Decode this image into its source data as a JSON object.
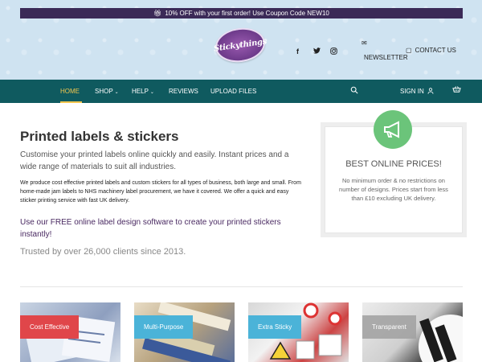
{
  "promo": {
    "icon": "gift-icon",
    "text": "10% OFF with your first order! Use Coupon Code NEW10"
  },
  "logo": {
    "text": "Stickythings",
    "color": "#6d3a8a"
  },
  "social": {
    "facebook": "f",
    "twitter": "t",
    "instagram": "ig"
  },
  "header_links": {
    "newsletter": "NEWSLETTER",
    "contact": "CONTACT US"
  },
  "nav": {
    "items": [
      {
        "label": "HOME",
        "active": true
      },
      {
        "label": "SHOP",
        "has_dropdown": true
      },
      {
        "label": "HELP",
        "has_dropdown": true
      },
      {
        "label": "REVIEWS"
      },
      {
        "label": "UPLOAD FILES"
      }
    ],
    "sign_in": "SIGN IN",
    "colors": {
      "bar": "#0f5a5f",
      "active": "#f3c64e"
    }
  },
  "main": {
    "title": "Printed labels & stickers",
    "lead": "Customise your printed labels online quickly and easily. Instant prices and a wide range of materials to suit all industries.",
    "body": "We produce cost effective printed labels and custom stickers for all types of business, both large and small. From home-made jam labels to NHS machinery label procurement, we have it covered. We offer a quick and easy sticker printing service with fast UK delivery.",
    "promo_line": "Use our FREE online label design software to create your printed stickers instantly!",
    "trusted": "Trusted by over 26,000 clients since 2013."
  },
  "price_card": {
    "icon": "megaphone-icon",
    "title": "BEST ONLINE PRICES!",
    "text": "No minimum order & no restrictions on number of designs. Prices start from less than £10 excluding UK delivery."
  },
  "tiles": [
    {
      "label": "Cost Effective",
      "color": "#e0464a"
    },
    {
      "label": "Multi-Purpose",
      "color": "#4bb3d8"
    },
    {
      "label": "Extra Sticky",
      "color": "#4bb3d8"
    },
    {
      "label": "Transparent",
      "color": "#a0a0a0"
    }
  ]
}
